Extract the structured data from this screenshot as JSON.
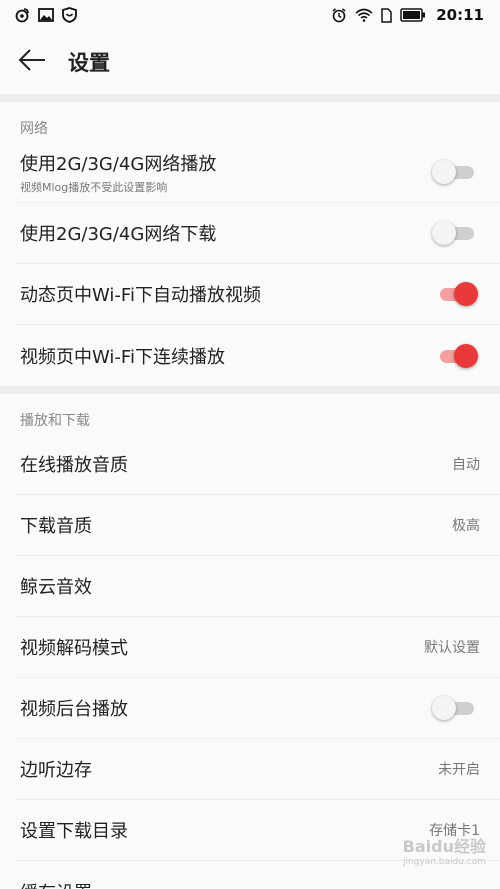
{
  "status_bar": {
    "left_icons": [
      "weibo-icon",
      "image-icon",
      "shield-icon"
    ],
    "right_icons": [
      "alarm-icon",
      "wifi-icon",
      "sim-icon",
      "battery-icon"
    ],
    "time": "20:11"
  },
  "title_bar": {
    "title": "设置"
  },
  "network": {
    "header": "网络",
    "items": [
      {
        "label": "使用2G/3G/4G网络播放",
        "sub": "视频Mlog播放不受此设置影响",
        "toggle": false
      },
      {
        "label": "使用2G/3G/4G网络下载",
        "toggle": false
      },
      {
        "label": "动态页中Wi-Fi下自动播放视频",
        "toggle": true
      },
      {
        "label": "视频页中Wi-Fi下连续播放",
        "toggle": true
      }
    ]
  },
  "playback": {
    "header": "播放和下载",
    "items": [
      {
        "label": "在线播放音质",
        "value": "自动"
      },
      {
        "label": "下载音质",
        "value": "极高"
      },
      {
        "label": "鲸云音效",
        "value": ""
      },
      {
        "label": "视频解码模式",
        "value": "默认设置"
      },
      {
        "label": "视频后台播放",
        "toggle": false
      },
      {
        "label": "边听边存",
        "value": "未开启"
      },
      {
        "label": "设置下载目录",
        "value": "存储卡1"
      },
      {
        "label": "缓存设置",
        "value": ""
      }
    ]
  },
  "watermark": {
    "text": "Baidu经验",
    "sub": "jingyan.baidu.com"
  },
  "colors": {
    "accent": "#e83a3a",
    "background": "#fafafa",
    "divider": "#eeeeee"
  }
}
